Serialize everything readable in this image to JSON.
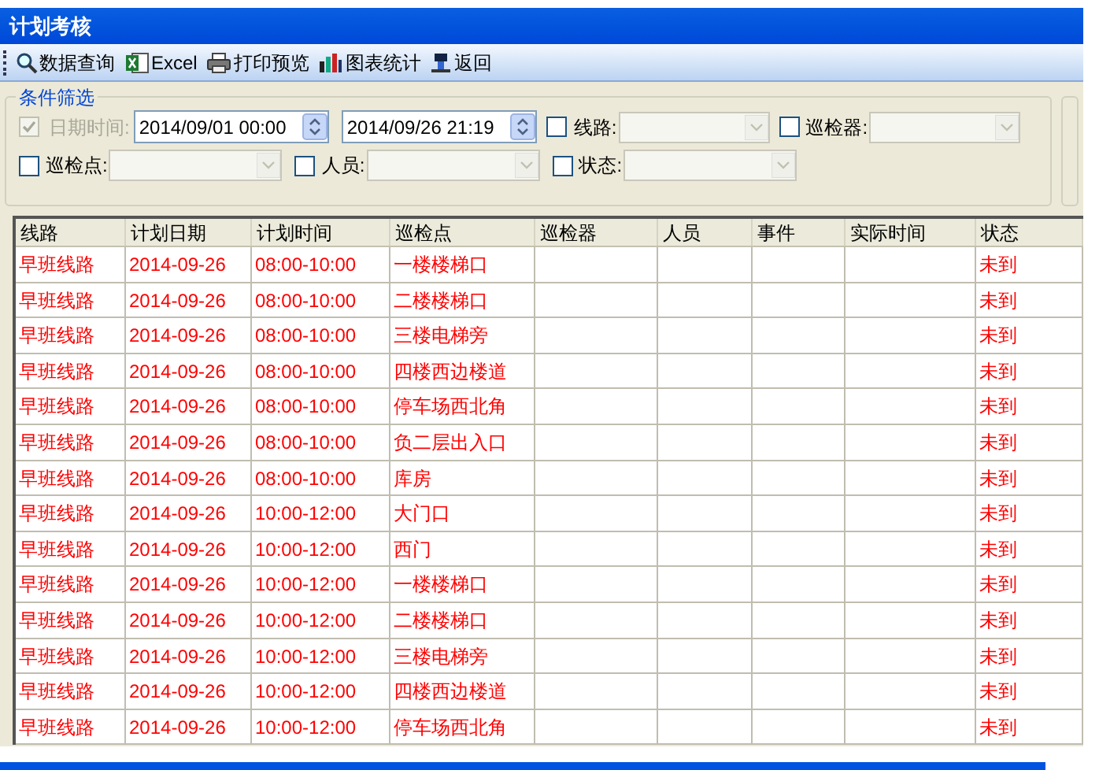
{
  "window": {
    "title": "计划考核"
  },
  "toolbar": [
    {
      "label": "数据查询"
    },
    {
      "label": "Excel"
    },
    {
      "label": "打印预览"
    },
    {
      "label": "图表统计"
    },
    {
      "label": "返回"
    }
  ],
  "filter": {
    "title": "条件筛选",
    "fields": [
      {
        "kind": "datetime",
        "label": "日期时间:",
        "checked": true,
        "disabled": true,
        "start": "2014/09/01 00:00",
        "end": "2014/09/26 21:19"
      },
      {
        "kind": "combo",
        "label": "线路:",
        "checked": false,
        "disabled": false
      },
      {
        "kind": "combo",
        "label": "巡检器:",
        "checked": false,
        "disabled": false
      },
      {
        "kind": "combo",
        "label": "巡检点:",
        "checked": false,
        "disabled": false
      },
      {
        "kind": "combo",
        "label": "人员:",
        "checked": false,
        "disabled": false
      },
      {
        "kind": "combo",
        "label": "状态:",
        "checked": false,
        "disabled": false
      }
    ]
  },
  "table": {
    "columns": [
      "线路",
      "计划日期",
      "计划时间",
      "巡检点",
      "巡检器",
      "人员",
      "事件",
      "实际时间",
      "状态"
    ],
    "rows": [
      [
        "早班线路",
        "2014-09-26",
        "08:00-10:00",
        "一楼楼梯口",
        "",
        "",
        "",
        "",
        "未到"
      ],
      [
        "早班线路",
        "2014-09-26",
        "08:00-10:00",
        "二楼楼梯口",
        "",
        "",
        "",
        "",
        "未到"
      ],
      [
        "早班线路",
        "2014-09-26",
        "08:00-10:00",
        "三楼电梯旁",
        "",
        "",
        "",
        "",
        "未到"
      ],
      [
        "早班线路",
        "2014-09-26",
        "08:00-10:00",
        "四楼西边楼道",
        "",
        "",
        "",
        "",
        "未到"
      ],
      [
        "早班线路",
        "2014-09-26",
        "08:00-10:00",
        "停车场西北角",
        "",
        "",
        "",
        "",
        "未到"
      ],
      [
        "早班线路",
        "2014-09-26",
        "08:00-10:00",
        "负二层出入口",
        "",
        "",
        "",
        "",
        "未到"
      ],
      [
        "早班线路",
        "2014-09-26",
        "08:00-10:00",
        "库房",
        "",
        "",
        "",
        "",
        "未到"
      ],
      [
        "早班线路",
        "2014-09-26",
        "10:00-12:00",
        "大门口",
        "",
        "",
        "",
        "",
        "未到"
      ],
      [
        "早班线路",
        "2014-09-26",
        "10:00-12:00",
        "西门",
        "",
        "",
        "",
        "",
        "未到"
      ],
      [
        "早班线路",
        "2014-09-26",
        "10:00-12:00",
        "一楼楼梯口",
        "",
        "",
        "",
        "",
        "未到"
      ],
      [
        "早班线路",
        "2014-09-26",
        "10:00-12:00",
        "二楼楼梯口",
        "",
        "",
        "",
        "",
        "未到"
      ],
      [
        "早班线路",
        "2014-09-26",
        "10:00-12:00",
        "三楼电梯旁",
        "",
        "",
        "",
        "",
        "未到"
      ],
      [
        "早班线路",
        "2014-09-26",
        "10:00-12:00",
        "四楼西边楼道",
        "",
        "",
        "",
        "",
        "未到"
      ],
      [
        "早班线路",
        "2014-09-26",
        "10:00-12:00",
        "停车场西北角",
        "",
        "",
        "",
        "",
        "未到"
      ]
    ]
  }
}
